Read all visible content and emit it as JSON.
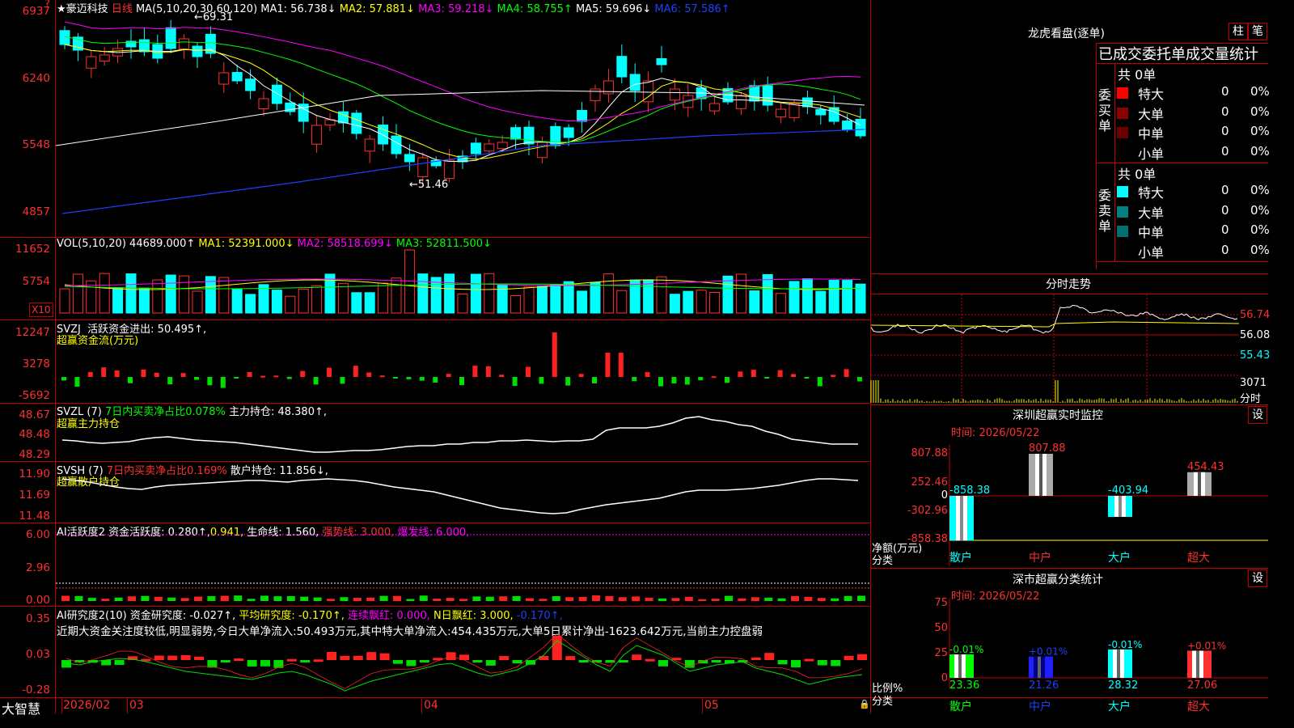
{
  "stock": {
    "star": "★",
    "name": "豪迈科技",
    "period": "日线"
  },
  "main_ma": {
    "label": "MA(5,10,20,30,60,120)",
    "ma1": "MA1: 56.738↓",
    "ma2": "MA2: 57.881↓",
    "ma3": "MA3: 59.218↓",
    "ma4": "MA4: 58.755↑",
    "ma5": "MA5: 59.696↓",
    "ma6": "MA6: 57.586↑"
  },
  "price_axis": [
    "6937",
    "6240",
    "5548",
    "4857"
  ],
  "price_marks": {
    "high": "69.31",
    "low": "51.46"
  },
  "vol": {
    "label": "VOL(5,10,20)",
    "value": "44689.000↑",
    "ma1": "MA1: 52391.000↓",
    "ma2": "MA2: 58518.699↓",
    "ma3": "MA3: 52811.500↓",
    "axis": [
      "11652",
      "5754"
    ],
    "unit": "X10"
  },
  "svzj": {
    "label": "SVZJ",
    "desc": "活跃资金进出: 50.495↑,",
    "sub": "超赢资金流(万元)",
    "axis": [
      "12247",
      "3278",
      "-5692"
    ]
  },
  "svzl": {
    "label": "SVZL (7)",
    "desc": "7日内买卖净占比0.078%",
    "pos": "主力持仓: 48.380↑,",
    "sub": "超赢主力持仓",
    "axis": [
      "48.67",
      "48.48",
      "48.29"
    ]
  },
  "svsh": {
    "label": "SVSH (7)",
    "desc": "7日内买卖净占比0.169%",
    "pos": "散户持仓: 11.856↓,",
    "sub": "超赢散户持仓",
    "axis": [
      "11.90",
      "11.69",
      "11.48"
    ]
  },
  "ai1": {
    "label": "AI活跃度2",
    "a": "资金活跃度: 0.280↑,",
    "b": "0.941,",
    "c": "生命线: 1.560,",
    "d": "强势线: 3.000,",
    "e": "爆发线: 6.000,",
    "axis": [
      "6.00",
      "2.96",
      "0.00"
    ]
  },
  "ai2": {
    "label": "AI研究度2(10)",
    "a": "资金研究度: -0.027↑,",
    "b": "平均研究度: -0.170↑,",
    "c": "连续飘红: 0.000,",
    "d": "N日飘红: 3.000,",
    "e": "-0.170↑,",
    "text": "近期大资金关注度较低,明显弱势,今日大单净流入:50.493万元,其中特大单净流入:454.435万元,大单5日累计净出-1623.642万元,当前主力控盘弱",
    "axis": [
      "0.35",
      "0.03",
      "-0.28"
    ]
  },
  "bottom": {
    "brand": "大智慧",
    "y": "2026/02",
    "m1": "03",
    "m2": "04",
    "m3": "05"
  },
  "lhb": {
    "title": "龙虎看盘(逐单)",
    "btn1": "柱",
    "btn2": "笔",
    "header": "已成交委托单成交量统计",
    "buy_group": "委买单",
    "sell_group": "委卖单",
    "buy_total": "共 0单",
    "sell_total": "共 0单",
    "rows": [
      "特大",
      "大单",
      "中单",
      "小单"
    ],
    "count": "0",
    "pct": "0%",
    "buy_colors": [
      "#ff0000",
      "#8b0000",
      "#6a0000",
      "#000000"
    ],
    "sell_colors": [
      "#00ffff",
      "#008080",
      "#007070",
      "#000000"
    ]
  },
  "fenshi": {
    "title": "分时走势",
    "axis": [
      "56.74",
      "56.08",
      "55.43",
      "3071"
    ],
    "fenshi_label": "分时"
  },
  "sz_monitor": {
    "title": "深圳超赢实时监控",
    "btn": "设",
    "date": "时间: 2026/05/22",
    "axis": [
      "807.88",
      "252.46",
      "0",
      "-302.96",
      "-858.38"
    ],
    "label1": "净额(万元)",
    "label2": "分类",
    "cats": [
      "散户",
      "中户",
      "大户",
      "超大"
    ],
    "values": [
      -858.38,
      807.88,
      -403.94,
      454.43
    ],
    "value_labels": [
      "-858.38",
      "807.88",
      "-403.94",
      "454.43"
    ]
  },
  "sz_class": {
    "title": "深市超赢分类统计",
    "btn": "设",
    "date": "时间: 2026/05/22",
    "axis": [
      "75",
      "50",
      "25",
      "0"
    ],
    "label1": "比例%",
    "label2": "分类",
    "cats": [
      "散户",
      "中户",
      "大户",
      "超大"
    ],
    "values": [
      23.36,
      21.26,
      28.32,
      27.06
    ],
    "value_labels": [
      "23.36",
      "21.26",
      "28.32",
      "27.06"
    ],
    "changes": [
      "-0.01%",
      "+0.01%",
      "-0.01%",
      "+0.01%"
    ]
  }
}
